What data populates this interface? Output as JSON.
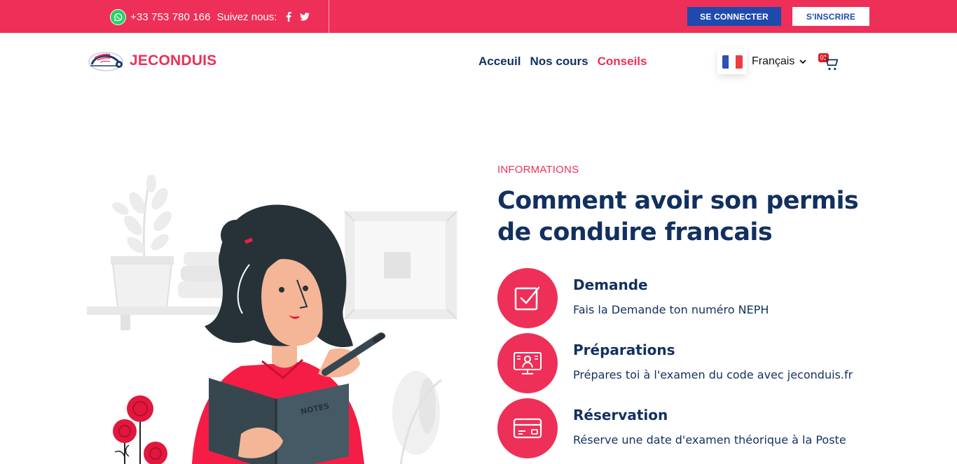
{
  "topbar": {
    "phone": "+33 753 780 166",
    "follow_label": "Suivez nous:",
    "login_label": "SE CONNECTER",
    "register_label": "S'INSCRIRE",
    "social_icons": [
      "facebook-icon",
      "twitter-icon"
    ]
  },
  "brand": {
    "name": "JECONDUIS"
  },
  "nav": {
    "items": [
      {
        "label": "Acceuil",
        "active": false
      },
      {
        "label": "Nos cours",
        "active": false
      },
      {
        "label": "Conseils",
        "active": true
      }
    ]
  },
  "language": {
    "selected": "Français"
  },
  "cart": {
    "count": "01"
  },
  "hero": {
    "eyebrow": "INFORMATIONS",
    "title": "Comment avoir son permis de conduire francais",
    "illustration_text": "NOTES"
  },
  "features": [
    {
      "icon": "checkbox-icon",
      "title": "Demande",
      "description": "Fais la Demande ton numéro NEPH"
    },
    {
      "icon": "monitor-user-icon",
      "title": "Préparations",
      "description": "Prépares toi à l'examen du code avec jeconduis.fr"
    },
    {
      "icon": "credit-card-icon",
      "title": "Réservation",
      "description": "Réserve une date d'examen théorique à la Poste"
    }
  ],
  "colors": {
    "primary": "#ee2f57",
    "navy": "#12305f",
    "button_blue": "#1e4aad"
  }
}
